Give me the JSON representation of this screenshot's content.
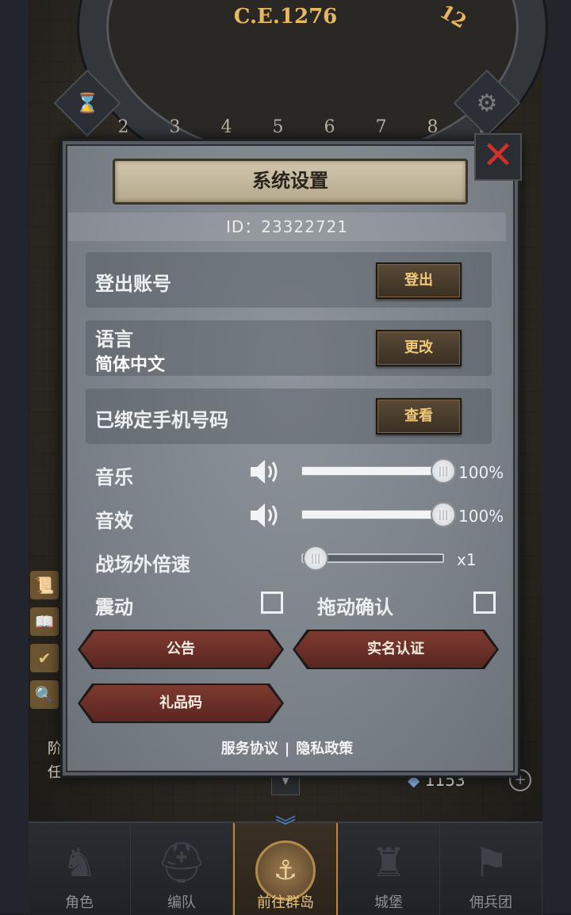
{
  "hud": {
    "calendar_year": "C.E.1276",
    "calendar_month": "12",
    "calendar_ring_numbers": "2 3 4 5 6 7 8 9 10 11",
    "hourglass_icon": "hourglass-icon",
    "gear_icon": "gear-icon",
    "resource_count": "1153",
    "side_text_1": "阶",
    "side_text_2": "任"
  },
  "dialog": {
    "title": "系统设置",
    "id_text": "ID：23322721",
    "logout": {
      "label": "登出账号",
      "button": "登出"
    },
    "language": {
      "label": "语言",
      "value": "简体中文",
      "button": "更改"
    },
    "phone": {
      "label": "已绑定手机号码",
      "button": "查看"
    },
    "music": {
      "label": "音乐",
      "value": "100%",
      "level": 1.0
    },
    "sound": {
      "label": "音效",
      "value": "100%",
      "level": 1.0
    },
    "speed": {
      "label": "战场外倍速",
      "value": "x1",
      "level": 0.0
    },
    "vibration": {
      "label": "震动",
      "checked": false
    },
    "drag_confirm": {
      "label": "拖动确认",
      "checked": false
    },
    "buttons": {
      "notice": "公告",
      "realname": "实名认证",
      "giftcode": "礼品码"
    },
    "footer": {
      "terms": "服务协议",
      "separator": "|",
      "privacy": "隐私政策"
    }
  },
  "bottom_nav": [
    {
      "label": "角色",
      "icon": "knight-icon"
    },
    {
      "label": "编队",
      "icon": "helmet-icon"
    },
    {
      "label": "前往群岛",
      "icon": "island-icon",
      "active": true
    },
    {
      "label": "城堡",
      "icon": "castle-icon"
    },
    {
      "label": "佣兵团",
      "icon": "flag-icon"
    }
  ],
  "colors": {
    "accent_gold": "#f1c978",
    "close_red": "#d2302a",
    "button_red": "#7d3a30"
  }
}
